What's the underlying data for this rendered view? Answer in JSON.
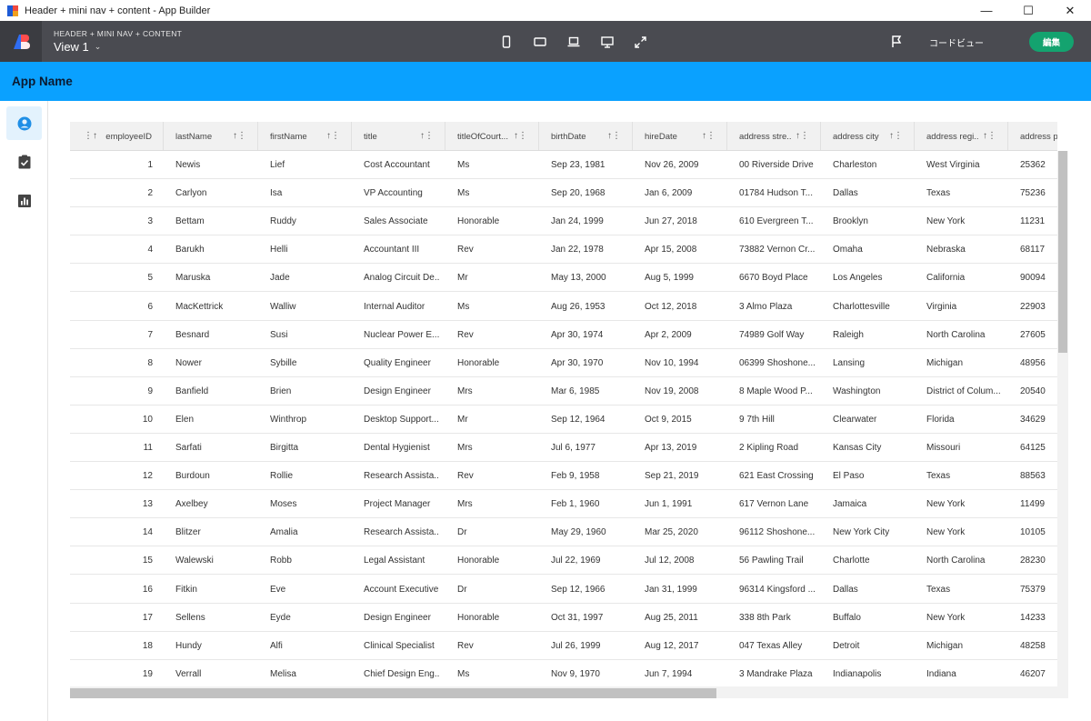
{
  "window": {
    "title": "Header + mini nav + content - App Builder",
    "minimize": "—",
    "maximize": "☐",
    "close": "✕"
  },
  "header": {
    "breadcrumb": "HEADER + MINI NAV + CONTENT",
    "view_name": "View 1",
    "code_view_label": "コードビュー",
    "edit_label": "編集"
  },
  "app": {
    "title": "App Name"
  },
  "colors": {
    "app_bar": "#0aa1ff",
    "builder_header": "#4a4b51",
    "edit_button": "#14a36f",
    "active_nav": "#e3f2fd"
  },
  "nav": {
    "items": [
      {
        "icon": "account-circle-icon",
        "active": true
      },
      {
        "icon": "assignment-check-icon",
        "active": false
      },
      {
        "icon": "bar-chart-icon",
        "active": false
      }
    ]
  },
  "grid": {
    "columns": [
      {
        "label": "employeeID"
      },
      {
        "label": "lastName"
      },
      {
        "label": "firstName"
      },
      {
        "label": "title"
      },
      {
        "label": "titleOfCourt..."
      },
      {
        "label": "birthDate"
      },
      {
        "label": "hireDate"
      },
      {
        "label": "address stre..."
      },
      {
        "label": "address city"
      },
      {
        "label": "address regi..."
      },
      {
        "label": "address po"
      }
    ],
    "rows": [
      [
        "1",
        "Newis",
        "Lief",
        "Cost Accountant",
        "Ms",
        "Sep 23, 1981",
        "Nov 26, 2009",
        "00 Riverside Drive",
        "Charleston",
        "West Virginia",
        "25362"
      ],
      [
        "2",
        "Carlyon",
        "Isa",
        "VP Accounting",
        "Ms",
        "Sep 20, 1968",
        "Jan 6, 2009",
        "01784 Hudson T...",
        "Dallas",
        "Texas",
        "75236"
      ],
      [
        "3",
        "Bettam",
        "Ruddy",
        "Sales Associate",
        "Honorable",
        "Jan 24, 1999",
        "Jun 27, 2018",
        "610 Evergreen T...",
        "Brooklyn",
        "New York",
        "11231"
      ],
      [
        "4",
        "Barukh",
        "Helli",
        "Accountant III",
        "Rev",
        "Jan 22, 1978",
        "Apr 15, 2008",
        "73882 Vernon Cr...",
        "Omaha",
        "Nebraska",
        "68117"
      ],
      [
        "5",
        "Maruska",
        "Jade",
        "Analog Circuit De...",
        "Mr",
        "May 13, 2000",
        "Aug 5, 1999",
        "6670 Boyd Place",
        "Los Angeles",
        "California",
        "90094"
      ],
      [
        "6",
        "MacKettrick",
        "Walliw",
        "Internal Auditor",
        "Ms",
        "Aug 26, 1953",
        "Oct 12, 2018",
        "3 Almo Plaza",
        "Charlottesville",
        "Virginia",
        "22903"
      ],
      [
        "7",
        "Besnard",
        "Susi",
        "Nuclear Power E...",
        "Rev",
        "Apr 30, 1974",
        "Apr 2, 2009",
        "74989 Golf Way",
        "Raleigh",
        "North Carolina",
        "27605"
      ],
      [
        "8",
        "Nower",
        "Sybille",
        "Quality Engineer",
        "Honorable",
        "Apr 30, 1970",
        "Nov 10, 1994",
        "06399 Shoshone...",
        "Lansing",
        "Michigan",
        "48956"
      ],
      [
        "9",
        "Banfield",
        "Brien",
        "Design Engineer",
        "Mrs",
        "Mar 6, 1985",
        "Nov 19, 2008",
        "8 Maple Wood P...",
        "Washington",
        "District of Colum...",
        "20540"
      ],
      [
        "10",
        "Elen",
        "Winthrop",
        "Desktop Support...",
        "Mr",
        "Sep 12, 1964",
        "Oct 9, 2015",
        "9 7th Hill",
        "Clearwater",
        "Florida",
        "34629"
      ],
      [
        "11",
        "Sarfati",
        "Birgitta",
        "Dental Hygienist",
        "Mrs",
        "Jul 6, 1977",
        "Apr 13, 2019",
        "2 Kipling Road",
        "Kansas City",
        "Missouri",
        "64125"
      ],
      [
        "12",
        "Burdoun",
        "Rollie",
        "Research Assista...",
        "Rev",
        "Feb 9, 1958",
        "Sep 21, 2019",
        "621 East Crossing",
        "El Paso",
        "Texas",
        "88563"
      ],
      [
        "13",
        "Axelbey",
        "Moses",
        "Project Manager",
        "Mrs",
        "Feb 1, 1960",
        "Jun 1, 1991",
        "617 Vernon Lane",
        "Jamaica",
        "New York",
        "11499"
      ],
      [
        "14",
        "Blitzer",
        "Amalia",
        "Research Assista...",
        "Dr",
        "May 29, 1960",
        "Mar 25, 2020",
        "96112 Shoshone...",
        "New York City",
        "New York",
        "10105"
      ],
      [
        "15",
        "Walewski",
        "Robb",
        "Legal Assistant",
        "Honorable",
        "Jul 22, 1969",
        "Jul 12, 2008",
        "56 Pawling Trail",
        "Charlotte",
        "North Carolina",
        "28230"
      ],
      [
        "16",
        "Fitkin",
        "Eve",
        "Account Executive",
        "Dr",
        "Sep 12, 1966",
        "Jan 31, 1999",
        "96314 Kingsford ...",
        "Dallas",
        "Texas",
        "75379"
      ],
      [
        "17",
        "Sellens",
        "Eyde",
        "Design Engineer",
        "Honorable",
        "Oct 31, 1997",
        "Aug 25, 2011",
        "338 8th Park",
        "Buffalo",
        "New York",
        "14233"
      ],
      [
        "18",
        "Hundy",
        "Alfi",
        "Clinical Specialist",
        "Rev",
        "Jul 26, 1999",
        "Aug 12, 2017",
        "047 Texas Alley",
        "Detroit",
        "Michigan",
        "48258"
      ],
      [
        "19",
        "Verrall",
        "Melisa",
        "Chief Design Eng...",
        "Ms",
        "Nov 9, 1970",
        "Jun 7, 1994",
        "3 Mandrake Plaza",
        "Indianapolis",
        "Indiana",
        "46207"
      ]
    ]
  }
}
